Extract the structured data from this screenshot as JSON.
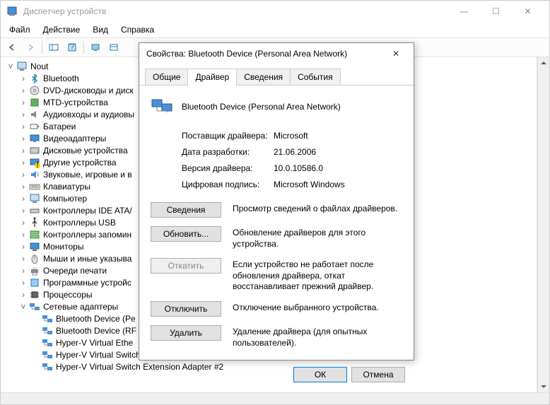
{
  "window": {
    "title": "Диспетчер устройств",
    "min": "—",
    "max": "☐",
    "close": "✕"
  },
  "menu": {
    "file": "Файл",
    "action": "Действие",
    "view": "Вид",
    "help": "Справка"
  },
  "tree": {
    "root": "Nout",
    "items": [
      "Bluetooth",
      "DVD-дисководы и диск",
      "MTD-устройства",
      "Аудиовходы и аудиовы",
      "Батареи",
      "Видеоадаптеры",
      "Дисковые устройства",
      "Другие устройства",
      "Звуковые, игровые и в",
      "Клавиатуры",
      "Компьютер",
      "Контроллеры IDE ATA/",
      "Контроллеры USB",
      "Контроллеры запомин",
      "Мониторы",
      "Мыши и иные указыва",
      "Очереди печати",
      "Программные устройс",
      "Процессоры",
      "Сетевые адаптеры"
    ],
    "net_children": [
      "Bluetooth Device (Pe",
      "Bluetooth Device (RF",
      "Hyper-V Virtual Ethe",
      "Hyper-V Virtual Switch Extension Adapter",
      "Hyper-V Virtual Switch Extension Adapter #2"
    ]
  },
  "dialog": {
    "title": "Свойства: Bluetooth Device (Personal Area Network)",
    "tabs": {
      "general": "Общие",
      "driver": "Драйвер",
      "details": "Сведения",
      "events": "События"
    },
    "device_name": "Bluetooth Device (Personal Area Network)",
    "labels": {
      "provider": "Поставщик драйвера:",
      "date": "Дата разработки:",
      "version": "Версия драйвера:",
      "signer": "Цифровая подпись:"
    },
    "values": {
      "provider": "Microsoft",
      "date": "21.06.2006",
      "version": "10.0.10586.0",
      "signer": "Microsoft Windows"
    },
    "buttons": {
      "details": "Сведения",
      "update": "Обновить...",
      "rollback": "Откатить",
      "disable": "Отключить",
      "uninstall": "Удалить"
    },
    "desc": {
      "details": "Просмотр сведений о файлах драйверов.",
      "update": "Обновление драйверов для этого устройства.",
      "rollback": "Если устройство не работает после обновления драйвера, откат восстанавливает прежний драйвер.",
      "disable": "Отключение выбранного устройства.",
      "uninstall": "Удаление драйвера (для опытных пользователей)."
    },
    "ok": "ОК",
    "cancel": "Отмена"
  }
}
